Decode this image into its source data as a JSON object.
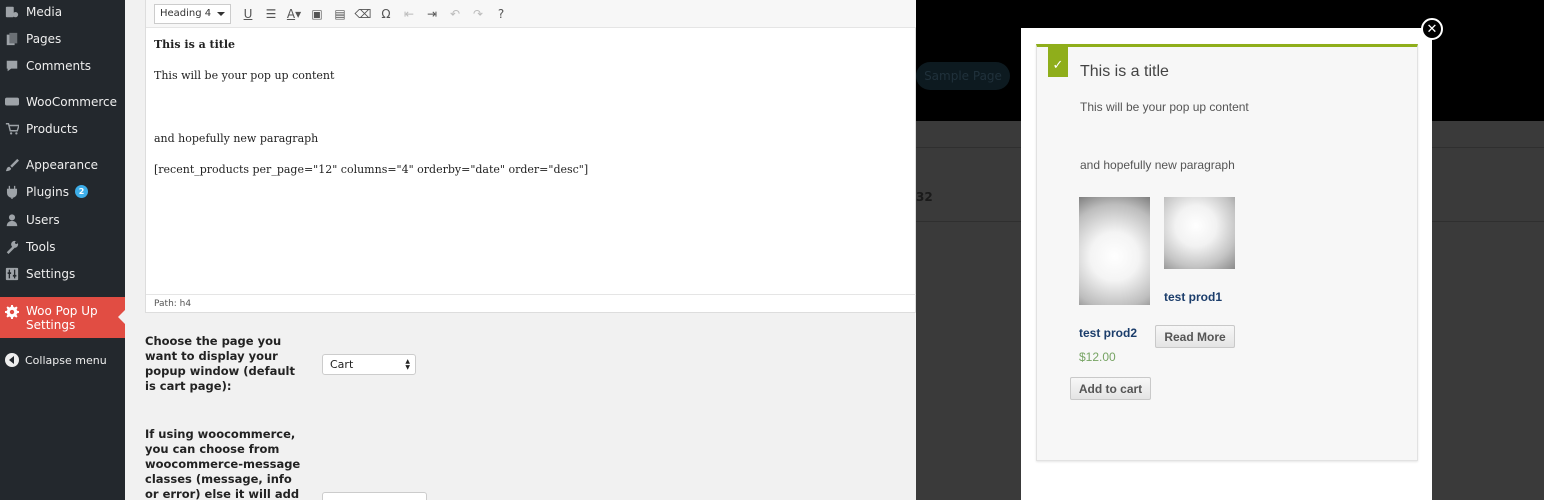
{
  "sidebar": {
    "items": [
      {
        "label": "Media",
        "icon": "media-icon"
      },
      {
        "label": "Pages",
        "icon": "pages-icon"
      },
      {
        "label": "Comments",
        "icon": "comments-icon"
      },
      {
        "label": "WooCommerce",
        "icon": "woocommerce-icon"
      },
      {
        "label": "Products",
        "icon": "products-cart-icon"
      },
      {
        "label": "Appearance",
        "icon": "appearance-brush-icon"
      },
      {
        "label": "Plugins",
        "icon": "plugins-icon",
        "badge": "2"
      },
      {
        "label": "Users",
        "icon": "users-icon"
      },
      {
        "label": "Tools",
        "icon": "tools-wrench-icon"
      },
      {
        "label": "Settings",
        "icon": "settings-icon"
      }
    ],
    "active": {
      "line1": "Woo Pop Up",
      "line2": "Settings",
      "icon": "gear-icon"
    },
    "collapse_label": "Collapse menu"
  },
  "editor": {
    "format_select": "Heading 4",
    "content": {
      "title": "This is a title",
      "line1": "This will be your pop up content",
      "line2": "and hopefully new paragraph",
      "shortcode": "[recent_products per_page=\"12\" columns=\"4\" orderby=\"date\" order=\"desc\"]"
    },
    "path": "Path: h4"
  },
  "settings": {
    "page_label": "Choose the page you want to display your popup window (default is cart page):",
    "page_value": "Cart",
    "class_label": "If using woocommerce, you can choose from woocommerce-message classes (message, info or error) else it will add a"
  },
  "background": {
    "nav_button": "Sample Page",
    "cell_text": "32"
  },
  "popup": {
    "title": "This is a title",
    "content": "This will be your pop up content",
    "paragraph": "and hopefully new paragraph",
    "close_symbol": "✕",
    "check_symbol": "✓",
    "products": [
      {
        "name": "test prod2",
        "price": "$12.00",
        "button": "Add to cart"
      },
      {
        "name": "test prod1",
        "button": "Read More"
      }
    ]
  },
  "colors": {
    "sidebar_bg": "#23282d",
    "active_menu": "#e14d43",
    "accent_green": "#8fae1b",
    "price_green": "#77a464",
    "product_link": "#1b3d6b"
  }
}
